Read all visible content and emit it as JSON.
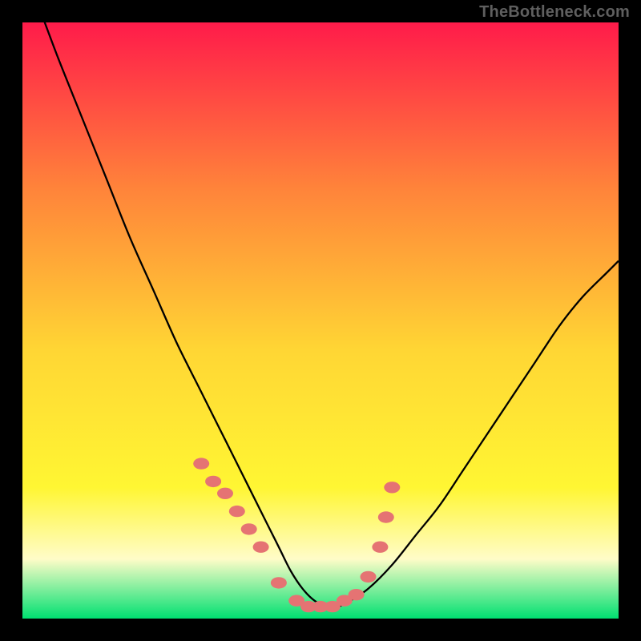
{
  "attribution": "TheBottleneck.com",
  "chart_data": {
    "type": "line",
    "title": "",
    "xlabel": "",
    "ylabel": "",
    "xlim": [
      0,
      100
    ],
    "ylim": [
      0,
      100
    ],
    "grid": false,
    "legend": false,
    "background_gradient": {
      "top": "#ff1b4a",
      "upper_mid": "#ff843a",
      "mid": "#ffd634",
      "lower_mid": "#fff633",
      "near_bottom": "#fffcc8",
      "bottom": "#00e071"
    },
    "series": [
      {
        "name": "bottleneck-curve",
        "x": [
          3,
          6,
          10,
          14,
          18,
          22,
          26,
          30,
          34,
          38,
          41,
          43,
          45,
          47,
          49,
          51,
          53,
          55,
          58,
          62,
          66,
          70,
          74,
          78,
          82,
          86,
          90,
          94,
          98,
          100
        ],
        "y": [
          102,
          94,
          84,
          74,
          64,
          55,
          46,
          38,
          30,
          22,
          16,
          12,
          8,
          5,
          3,
          2,
          2,
          3,
          5,
          9,
          14,
          19,
          25,
          31,
          37,
          43,
          49,
          54,
          58,
          60
        ],
        "color": "#000000",
        "linewidth": 2.3
      },
      {
        "name": "marker-points",
        "type": "scatter",
        "x": [
          30,
          32,
          34,
          36,
          38,
          40,
          43,
          46,
          48,
          50,
          52,
          54,
          56,
          58,
          60,
          61,
          62
        ],
        "y": [
          26,
          23,
          21,
          18,
          15,
          12,
          6,
          3,
          2,
          2,
          2,
          3,
          4,
          7,
          12,
          17,
          22
        ],
        "color": "#e57373",
        "size": 10
      }
    ]
  }
}
